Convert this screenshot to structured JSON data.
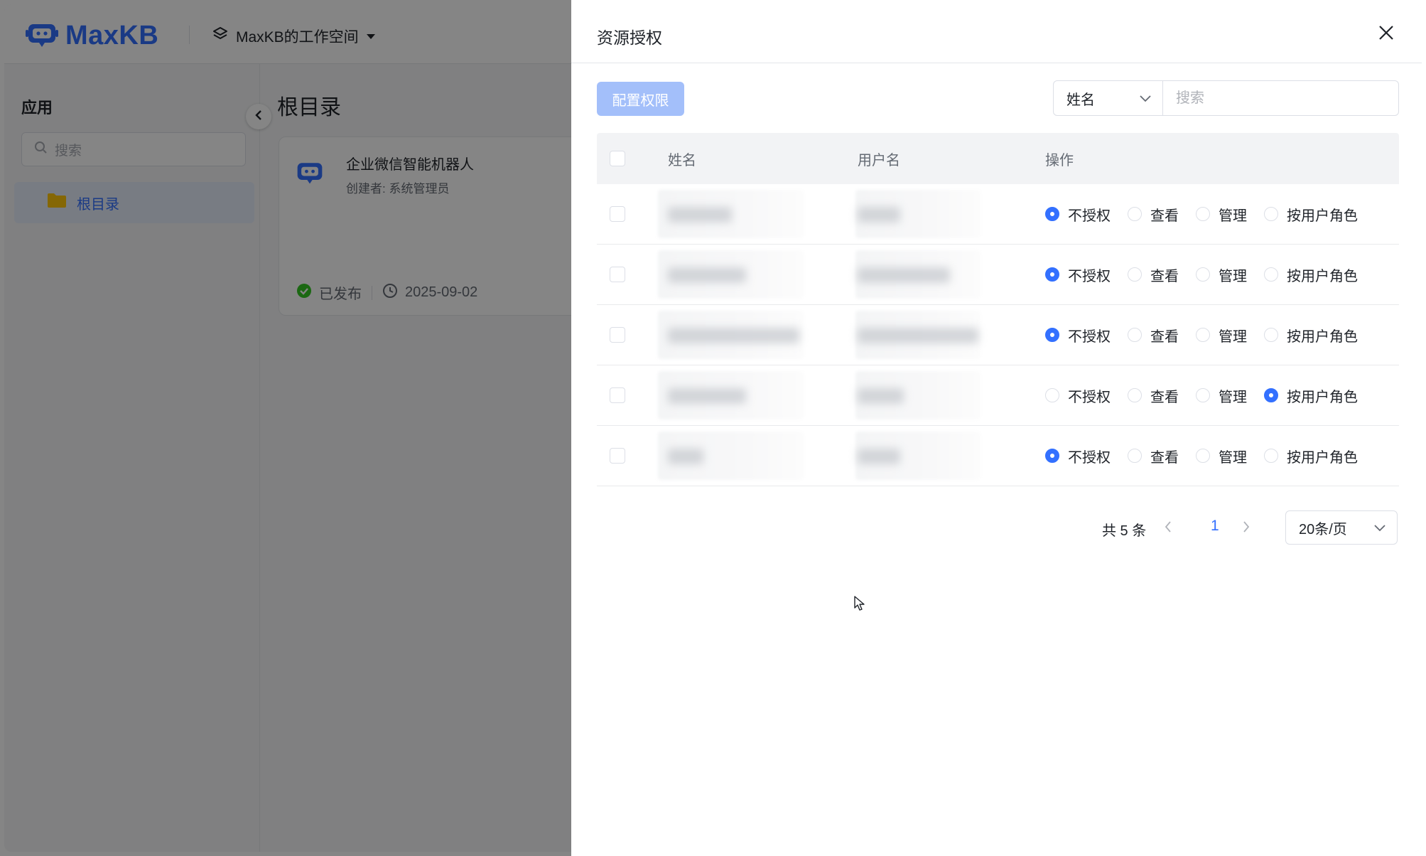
{
  "app": {
    "logo_text": "MaxKB",
    "workspace": "MaxKB的工作空间",
    "sidebar_title": "应用",
    "sidebar_search_placeholder": "搜索",
    "tree_root": "根目录",
    "main_title": "根目录",
    "card": {
      "name": "企业微信智能机器人",
      "creator": "创建者: 系统管理员",
      "status": "已发布",
      "date": "2025-09-02"
    }
  },
  "drawer": {
    "title": "资源授权",
    "config_button": "配置权限",
    "filter_field": "姓名",
    "search_placeholder": "搜索",
    "columns": {
      "name": "姓名",
      "username": "用户名",
      "operation": "操作"
    },
    "options": [
      "不授权",
      "查看",
      "管理",
      "按用户角色"
    ],
    "rows": [
      {
        "selected": 0
      },
      {
        "selected": 0
      },
      {
        "selected": 0
      },
      {
        "selected": 3
      },
      {
        "selected": 0
      }
    ],
    "pagination": {
      "total": "共 5 条",
      "page": "1",
      "page_size": "20条/页"
    }
  },
  "colors": {
    "primary": "#3370ff",
    "disabled_primary": "#a3bffa",
    "success": "#34c724",
    "folder": "#ffc60a"
  }
}
